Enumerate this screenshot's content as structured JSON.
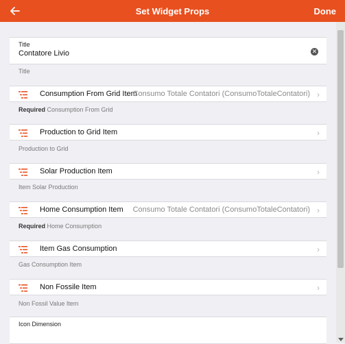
{
  "header": {
    "title": "Set Widget Props",
    "done_label": "Done"
  },
  "title_field": {
    "label": "Title",
    "value": "Contatore Livio",
    "hint": "Title"
  },
  "items": [
    {
      "label": "Consumption From Grid Item",
      "value": "Consumo Totale Contatori (ConsumoTotaleContatori)",
      "required_label": "Required",
      "hint": "Consumption From Grid"
    },
    {
      "label": "Production to Grid Item",
      "value": "",
      "required_label": "",
      "hint": "Production to Grid"
    },
    {
      "label": "Solar Production Item",
      "value": "",
      "required_label": "",
      "hint": "Item Solar Production"
    },
    {
      "label": "Home Consumption Item",
      "value": "Consumo Totale Contatori (ConsumoTotaleContatori)",
      "required_label": "Required",
      "hint": "Home Consumption"
    },
    {
      "label": "Item Gas Consumption",
      "value": "",
      "required_label": "",
      "hint": "Gas Consumption Item"
    },
    {
      "label": "Non Fossile Item",
      "value": "",
      "required_label": "",
      "hint": "Non Fossil Value Item"
    }
  ],
  "icon_dimension": {
    "label": "Icon Dimension"
  },
  "colors": {
    "accent": "#e8501f",
    "background": "#efeff4"
  },
  "icons": {
    "back": "arrow-left-icon",
    "clear": "clear-circle-icon",
    "item": "list-icon",
    "chevron": "chevron-right-icon"
  }
}
